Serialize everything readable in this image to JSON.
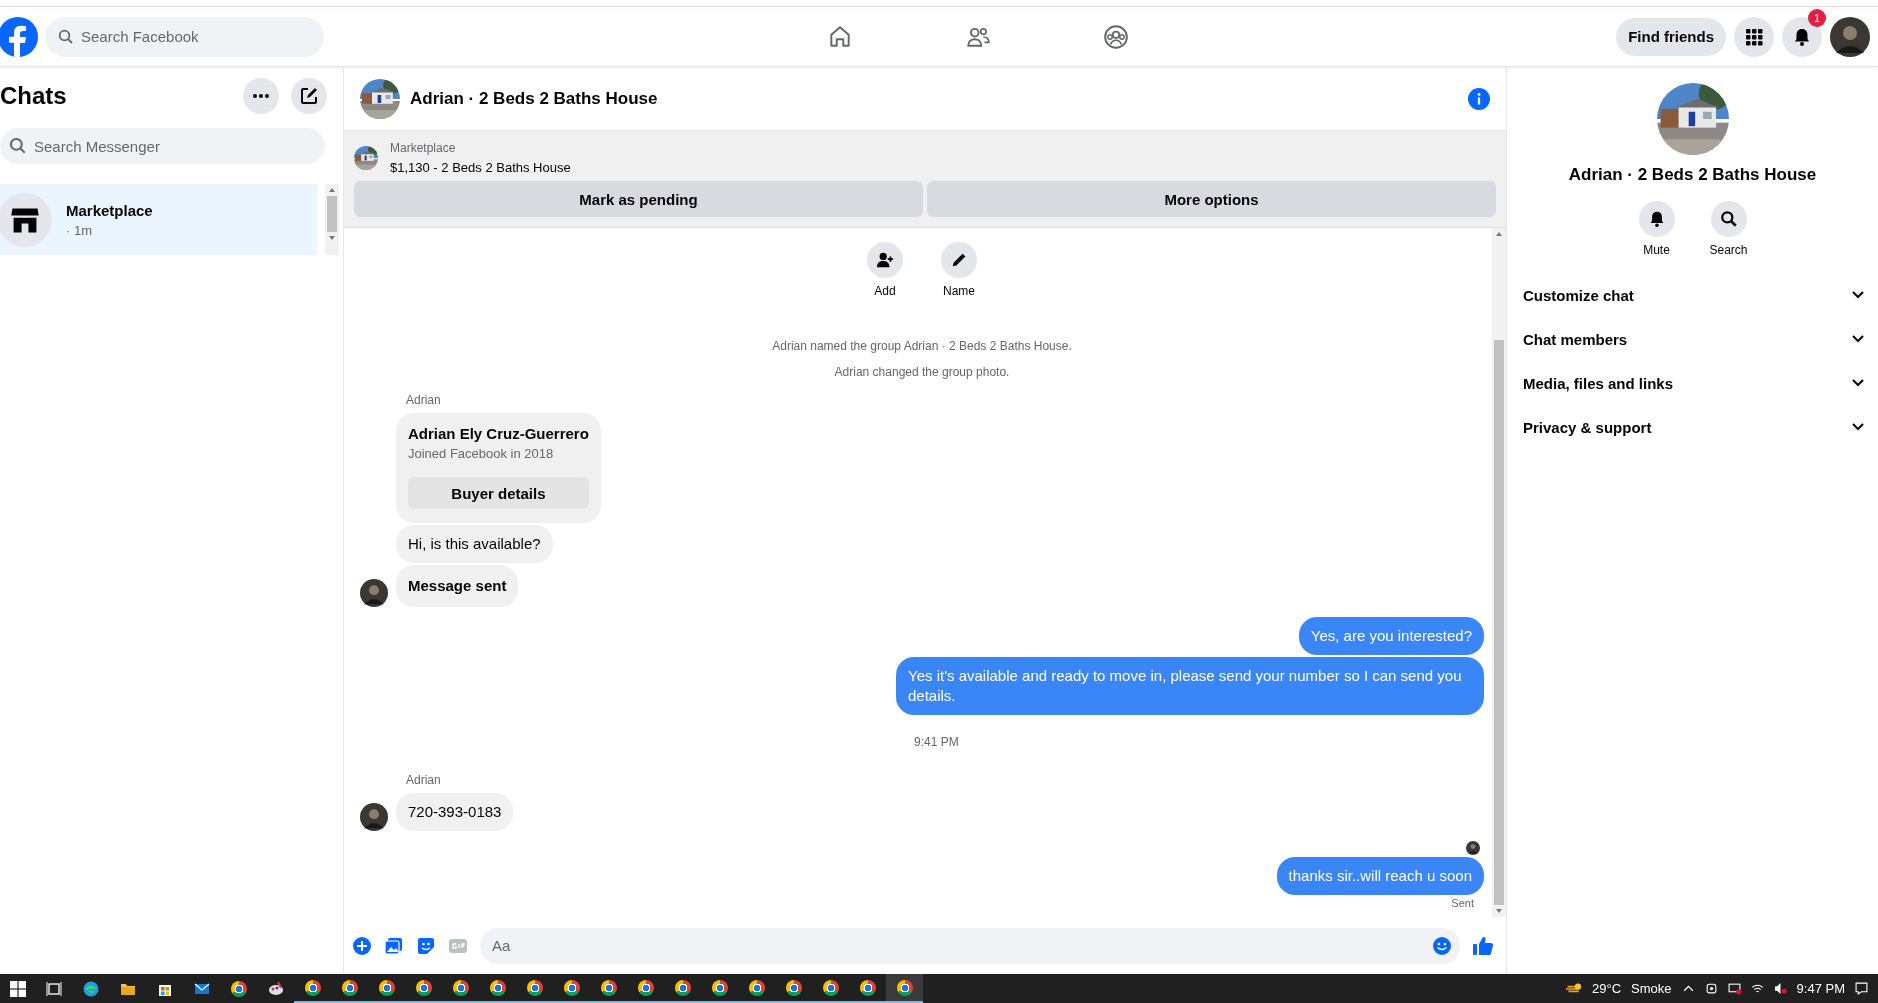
{
  "top_bar": {
    "search": {
      "placeholder": "Search Facebook"
    },
    "find_friends": "Find friends",
    "notification_count": "1"
  },
  "chats": {
    "title": "Chats",
    "search": {
      "placeholder": "Search Messenger"
    },
    "items": [
      {
        "name": "Marketplace",
        "time": "· 1m",
        "selected": true
      }
    ]
  },
  "conversation": {
    "title": "Adrian · 2 Beds 2 Baths House",
    "listing": {
      "source": "Marketplace",
      "title": "$1,130 - 2 Beds 2 Baths House",
      "actions": [
        "Mark as pending",
        "More options"
      ]
    },
    "group_actions": [
      {
        "kind": "add",
        "label": "Add"
      },
      {
        "kind": "name",
        "label": "Name"
      }
    ],
    "messages": [
      {
        "kind": "system",
        "text": "Adrian named the group Adrian · 2 Beds 2 Baths House."
      },
      {
        "kind": "system",
        "text": "Adrian changed the group photo."
      },
      {
        "kind": "sender",
        "text": "Adrian"
      },
      {
        "kind": "card",
        "title": "Adrian Ely Cruz-Guerrero",
        "subtitle": "Joined Facebook in 2018",
        "button": "Buyer details"
      },
      {
        "kind": "incoming",
        "text": "Hi, is this available?",
        "bold": false
      },
      {
        "kind": "incoming",
        "text": "Message sent",
        "bold": true
      },
      {
        "kind": "outgoing",
        "text": "Yes, are you interested?"
      },
      {
        "kind": "outgoing",
        "text": "Yes it's available and ready to move in, please send your number so I can send you details."
      },
      {
        "kind": "timestamp",
        "text": "9:41 PM"
      },
      {
        "kind": "sender",
        "text": "Adrian"
      },
      {
        "kind": "incoming",
        "text": "720-393-0183",
        "bold": false
      },
      {
        "kind": "seen"
      },
      {
        "kind": "outgoing",
        "text": "thanks sir..will reach u soon"
      },
      {
        "kind": "status",
        "text": "Sent"
      }
    ],
    "composer": {
      "placeholder": "Aa"
    }
  },
  "details": {
    "title": "Adrian · 2 Beds 2 Baths House",
    "actions": [
      {
        "kind": "mute",
        "label": "Mute"
      },
      {
        "kind": "search",
        "label": "Search"
      }
    ],
    "sections": [
      {
        "label": "Customize chat",
        "expanded": false
      },
      {
        "label": "Chat members",
        "expanded": false
      },
      {
        "label": "Media, files and links",
        "expanded": false
      },
      {
        "label": "Privacy & support",
        "expanded": false
      }
    ]
  },
  "taskbar": {
    "apps": [
      {
        "kind": "edge",
        "running": false,
        "selected": false
      },
      {
        "kind": "explorer",
        "running": false,
        "selected": false
      },
      {
        "kind": "store",
        "running": false,
        "selected": false
      },
      {
        "kind": "mail",
        "running": false,
        "selected": false
      },
      {
        "kind": "chrome",
        "running": false,
        "selected": false
      },
      {
        "kind": "paint",
        "running": false,
        "selected": false
      },
      {
        "kind": "chrome",
        "running": true,
        "selected": false
      },
      {
        "kind": "chrome",
        "running": true,
        "selected": false
      },
      {
        "kind": "chrome",
        "running": true,
        "selected": false
      },
      {
        "kind": "chrome",
        "running": true,
        "selected": false
      },
      {
        "kind": "chrome",
        "running": true,
        "selected": false
      },
      {
        "kind": "chrome",
        "running": true,
        "selected": false
      },
      {
        "kind": "chrome",
        "running": true,
        "selected": false
      },
      {
        "kind": "chrome",
        "running": true,
        "selected": false
      },
      {
        "kind": "chrome",
        "running": true,
        "selected": false
      },
      {
        "kind": "chrome",
        "running": true,
        "selected": false
      },
      {
        "kind": "chrome",
        "running": true,
        "selected": false
      },
      {
        "kind": "chrome",
        "running": true,
        "selected": false
      },
      {
        "kind": "chrome",
        "running": true,
        "selected": false
      },
      {
        "kind": "chrome",
        "running": true,
        "selected": false
      },
      {
        "kind": "chrome",
        "running": true,
        "selected": false
      },
      {
        "kind": "chrome",
        "running": true,
        "selected": false
      },
      {
        "kind": "chrome",
        "running": true,
        "selected": true
      }
    ],
    "temperature": "29°C",
    "weather": "Smoke",
    "time": "9:47 PM"
  }
}
